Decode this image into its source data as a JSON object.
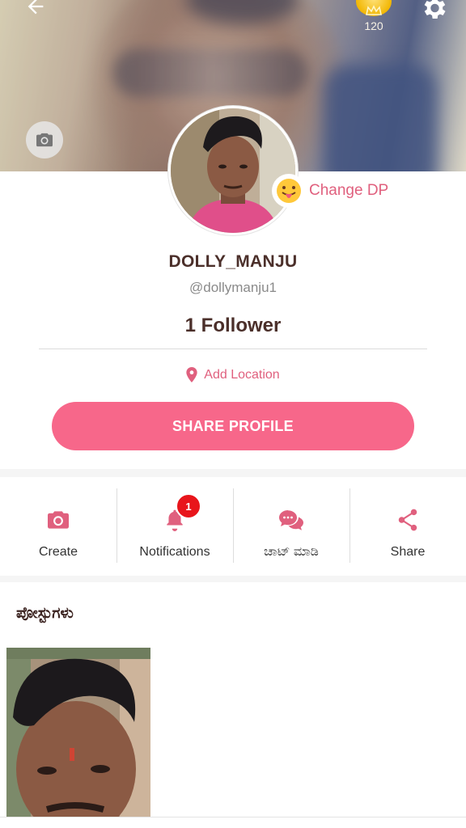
{
  "header": {
    "coin_count": "120"
  },
  "profile": {
    "change_dp_label": "Change DP",
    "username": "DOLLY_MANJU",
    "handle": "@dollymanju1",
    "followers": "1 Follower",
    "location_label": "Add Location",
    "share_profile_label": "SHARE PROFILE"
  },
  "actions": [
    {
      "label": "Create",
      "icon": "camera-icon"
    },
    {
      "label": "Notifications",
      "icon": "bell-icon",
      "badge": "1"
    },
    {
      "label": "ಚಾಟ್ ಮಾಡಿ",
      "icon": "chat-icon"
    },
    {
      "label": "Share",
      "icon": "share-icon"
    }
  ],
  "posts": {
    "title": "ಪೋಸ್ಟುಗಳು"
  },
  "colors": {
    "accent": "#f7678a",
    "accent_text": "#e0607e",
    "badge": "#e8151b",
    "name_text": "#4b2f2a"
  }
}
